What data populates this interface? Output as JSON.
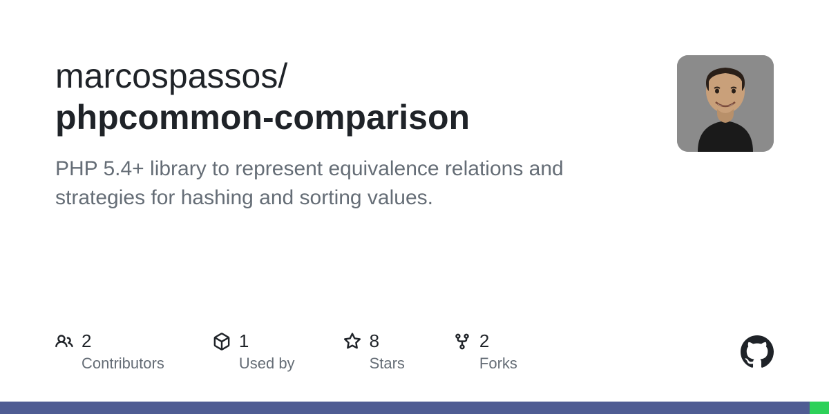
{
  "repo": {
    "owner": "marcospassos",
    "name": "phpcommon-comparison",
    "description": "PHP 5.4+ library to represent equivalence relations and strategies for hashing and sorting values."
  },
  "stats": {
    "contributors": {
      "value": "2",
      "label": "Contributors"
    },
    "usedby": {
      "value": "1",
      "label": "Used by"
    },
    "stars": {
      "value": "8",
      "label": "Stars"
    },
    "forks": {
      "value": "2",
      "label": "Forks"
    }
  },
  "colors": {
    "bar_primary": "#4f5c93",
    "bar_accent": "#2dd159"
  }
}
